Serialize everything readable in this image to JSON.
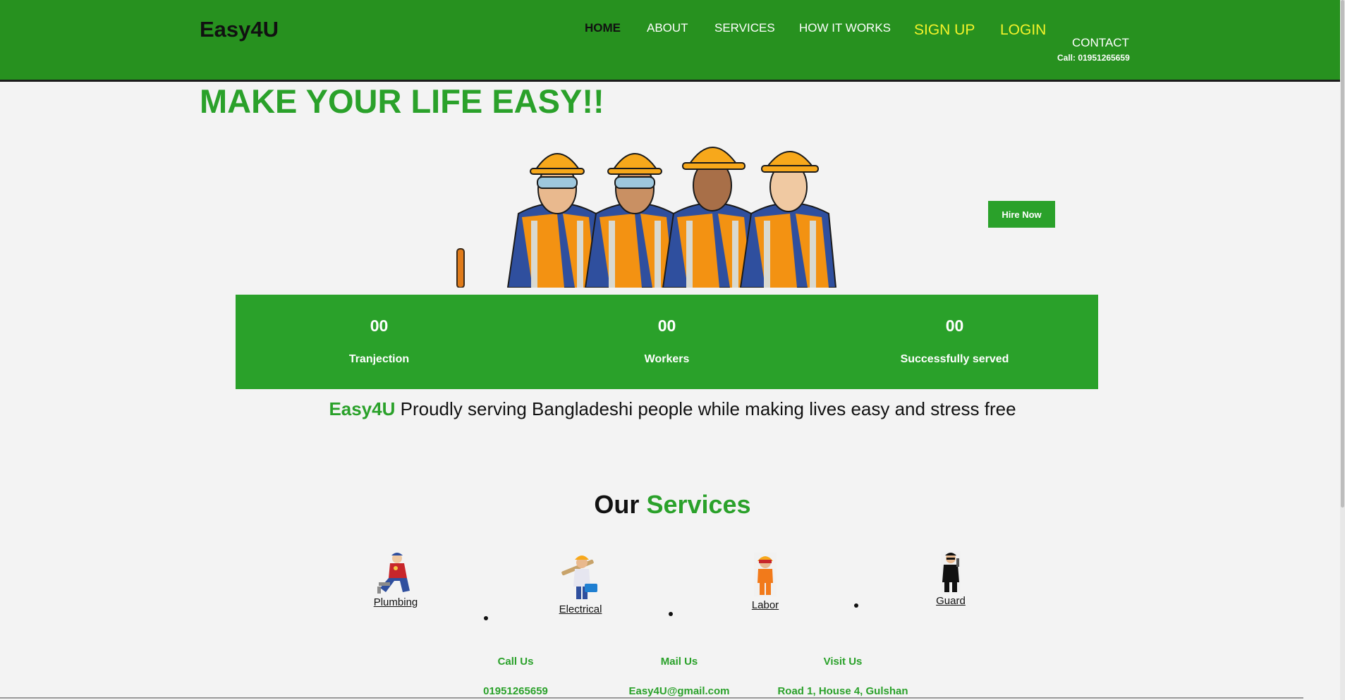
{
  "header": {
    "brand": "Easy4U",
    "nav": {
      "home": "HOME",
      "about": "ABOUT",
      "services": "SERVICES",
      "how_it_works": "HOW IT WORKS",
      "sign_up": "SIGN UP",
      "login": "LOGIN",
      "contact": "CONTACT"
    },
    "call": "Call: 01951265659"
  },
  "hero": {
    "title": "MAKE YOUR LIFE EASY!!",
    "hire_button": "Hire Now"
  },
  "stats": [
    {
      "value": "00",
      "label": "Tranjection"
    },
    {
      "value": "00",
      "label": "Workers"
    },
    {
      "value": "00",
      "label": "Successfully served"
    }
  ],
  "tagline": {
    "brand": "Easy4U",
    "text": "Proudly serving Bangladeshi people while making lives easy and stress free"
  },
  "services": {
    "title_start": "Our",
    "title_accent": "Services",
    "items": [
      {
        "label": "Plumbing"
      },
      {
        "label": "Electrical"
      },
      {
        "label": "Labor"
      },
      {
        "label": "Guard"
      }
    ]
  },
  "footer": {
    "call": {
      "heading": "Call Us",
      "value": "01951265659"
    },
    "mail": {
      "heading": "Mail Us",
      "value": "Easy4U@gmail.com"
    },
    "visit": {
      "heading": "Visit Us",
      "value": "Road 1, House 4, Gulshan"
    }
  },
  "colors": {
    "header_green": "#27911f",
    "accent_green": "#2aa12a",
    "nav_yellow": "#f3f32a",
    "background": "#f3f3f3"
  }
}
